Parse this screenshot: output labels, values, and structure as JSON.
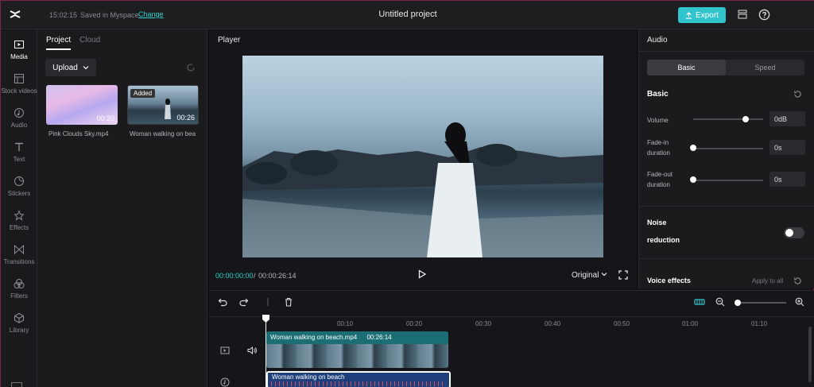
{
  "app": {
    "logo_icon": "capcut-logo-icon",
    "save_time": "15:02:15",
    "save_status": "Saved in Myspace",
    "change_link": "Change",
    "project_title": "Untitled project",
    "export_label": "Export",
    "accent": "#31c4cc"
  },
  "sidebar": {
    "items": [
      {
        "label": "Media",
        "icon": "media-icon"
      },
      {
        "label": "Stock videos",
        "icon": "stock-videos-icon"
      },
      {
        "label": "Audio",
        "icon": "audio-icon"
      },
      {
        "label": "Text",
        "icon": "text-icon"
      },
      {
        "label": "Stickers",
        "icon": "stickers-icon"
      },
      {
        "label": "Effects",
        "icon": "effects-icon"
      },
      {
        "label": "Transitions",
        "icon": "transitions-icon"
      },
      {
        "label": "Filters",
        "icon": "filters-icon"
      },
      {
        "label": "Library",
        "icon": "library-icon"
      }
    ]
  },
  "media": {
    "tabs": [
      "Project",
      "Cloud"
    ],
    "upload_label": "Upload",
    "items": [
      {
        "name": "Pink Clouds Sky.mp4",
        "duration": "00:20",
        "badge": ""
      },
      {
        "name": "Woman walking on bea",
        "duration": "00:26",
        "badge": "Added"
      }
    ]
  },
  "player": {
    "title": "Player",
    "time_current": "00:00:00:00",
    "time_separator": "/",
    "time_total": "00:00:26:14",
    "ratio_label": "Original"
  },
  "audio": {
    "title": "Audio",
    "tabs": [
      "Basic",
      "Speed"
    ],
    "section_basic": "Basic",
    "volume_label": "Volume",
    "volume_value": "0dB",
    "volume_level": 0.75,
    "fade_in_label_1": "Fade-in",
    "fade_in_label_2": "duration",
    "fade_in_value": "0s",
    "fade_out_label_1": "Fade-out",
    "fade_out_label_2": "duration",
    "fade_out_value": "0s",
    "noise_label_1": "Noise",
    "noise_label_2": "reduction",
    "noise_enabled": false,
    "voice_effects_label": "Voice effects",
    "apply_all_label": "Apply to all"
  },
  "timeline": {
    "ticks": [
      "00:10",
      "00:20",
      "00:30",
      "00:40",
      "00:50",
      "01:00",
      "01:10"
    ],
    "video_clip_name": "Woman walking on beach.mp4",
    "video_clip_duration": "00:26:14",
    "audio_clip_name": "Woman walking on beach"
  }
}
